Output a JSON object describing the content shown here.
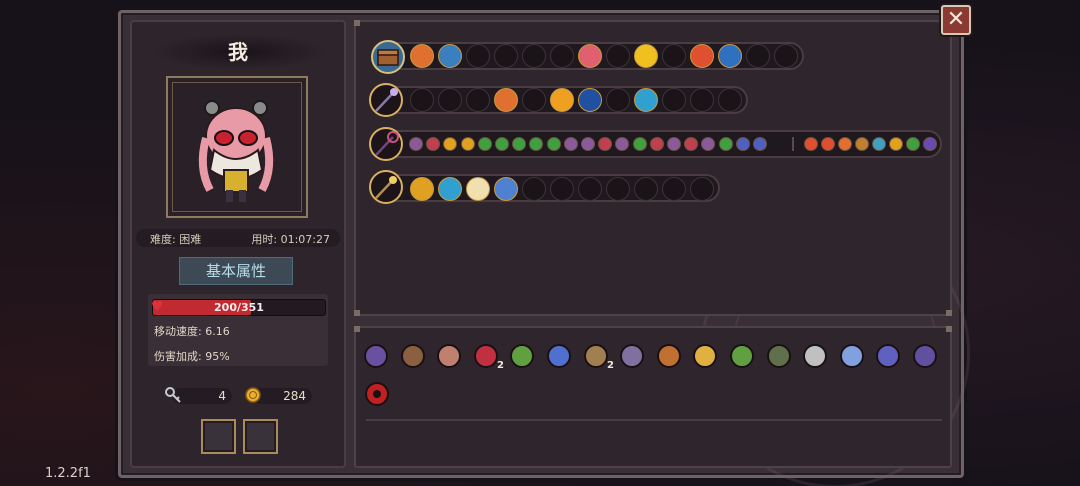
{
  "player": {
    "name": "我"
  },
  "info": {
    "difficulty": "难度: 困难",
    "time": "用时: 01:07:27"
  },
  "attributes": {
    "title": "基本属性",
    "hp": {
      "text": "200/351",
      "current": 200,
      "max": 351
    },
    "move_speed": "移动速度: 6.16",
    "damage_bonus": "伤害加成: 95%"
  },
  "resources": {
    "keys": "4",
    "coins": "284"
  },
  "items": {
    "counts": {
      "item4": "2",
      "item8": "2"
    }
  },
  "icons": [
    "close-icon",
    "key-icon",
    "coin-icon",
    "heart-icon",
    "staff-icon",
    "wand-icon",
    "chest-icon",
    "potion-icon",
    "crystal-icon",
    "gem-icon"
  ],
  "colors": {
    "hp": "#c02a30",
    "frame": "#3a2f37",
    "accent_gold": "#d8b060",
    "attr_title": "#b8dce8"
  },
  "version": "1.2.2f1"
}
